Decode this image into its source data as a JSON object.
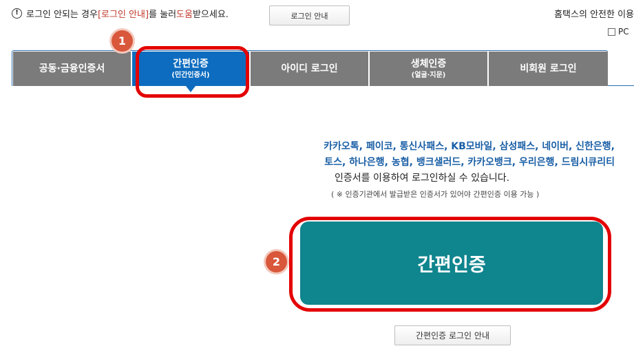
{
  "notice": {
    "icon": "exclamation-circle-icon",
    "text_before": "로그인 안되는 경우 ",
    "link_text": "[로그인 안내]",
    "text_mid": "를 눌러 ",
    "help_text": "도움",
    "text_after": "받으세요.",
    "button_label": "로그인 안내"
  },
  "top_right": {
    "text": "홈택스의 안전한 이용",
    "pc_label": "PC"
  },
  "tabs": [
    {
      "label": "공동·금융인증서",
      "sub": ""
    },
    {
      "label": "간편인증",
      "sub": "(민간인증서)"
    },
    {
      "label": "아이디 로그인",
      "sub": ""
    },
    {
      "label": "생체인증",
      "sub": "(얼굴·지문)"
    },
    {
      "label": "비회원 로그인",
      "sub": ""
    }
  ],
  "badges": [
    "1",
    "2"
  ],
  "content": {
    "providers_line1": "카카오톡, 페이코, 통신사패스, KB모바일, 삼성패스, 네이버, 신한은행,",
    "providers_line2": "토스, 하나은행, 농협, 뱅크샐러드, 카카오뱅크, 우리은행, 드림시큐리티",
    "use_text": "인증서를 이용하여 로그인하실 수 있습니다.",
    "note_text": "( ※ 인증기관에서 발급받은 인증서가 있어야 간편인증 이용 가능 )",
    "main_button": "간편인증",
    "guide_button": "간편인증 로그인 안내"
  },
  "colors": {
    "active_tab": "#0d6cbf",
    "inactive_tab": "#7b7b7b",
    "main_button": "#0f858e",
    "highlight": "#e30000",
    "badge": "#d9573b",
    "provider_text": "#1a5fa6"
  }
}
